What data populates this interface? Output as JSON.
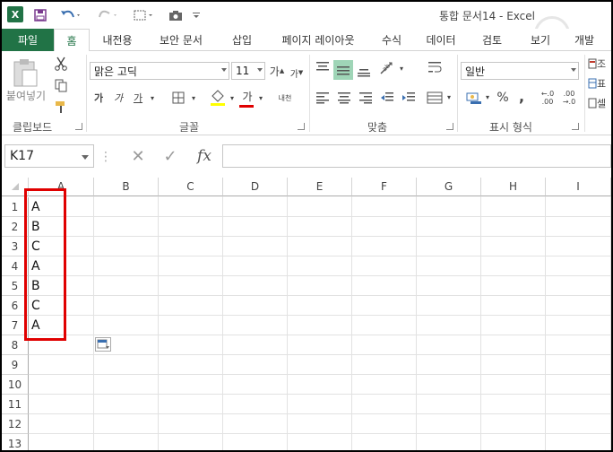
{
  "title": "통합 문서14 - Excel",
  "tabs": [
    "파일",
    "홈",
    "내전용",
    "보안 문서",
    "삽입",
    "페이지 레이아웃",
    "수식",
    "데이터",
    "검토",
    "보기",
    "개발"
  ],
  "ribbon": {
    "clipboard": {
      "paste_label": "붙여넣기",
      "group_label": "클립보드"
    },
    "font": {
      "font_name": "맑은 고딕",
      "font_size": "11",
      "group_label": "글꼴",
      "grow_label": "가",
      "shrink_label": "가",
      "bold": "가",
      "italic": "가",
      "underline": "가",
      "font_color_letter": "가",
      "phonetic_label": "내천"
    },
    "alignment": {
      "group_label": "맞춤"
    },
    "number": {
      "format": "일반",
      "group_label": "표시 형식",
      "percent": "%",
      "comma": ",",
      "inc_decimal": "←.0 .00",
      "dec_decimal": ".00 →.0"
    },
    "styles_partial": [
      "조",
      "표",
      "셀"
    ]
  },
  "formula_bar": {
    "name_box": "K17",
    "cancel": "✕",
    "enter": "✓",
    "fx": "fx",
    "value": ""
  },
  "grid": {
    "columns": [
      "A",
      "B",
      "C",
      "D",
      "E",
      "F",
      "G",
      "H",
      "I"
    ],
    "rows": [
      "1",
      "2",
      "3",
      "4",
      "5",
      "6",
      "7",
      "8",
      "9",
      "10",
      "11",
      "12",
      "13"
    ],
    "column_a_values": [
      "A",
      "B",
      "C",
      "A",
      "B",
      "C",
      "A"
    ]
  },
  "colors": {
    "excel_green": "#217346",
    "highlight": "#9fd5b7",
    "annotation_red": "#e00000",
    "font_color_bar": "#e00000"
  }
}
